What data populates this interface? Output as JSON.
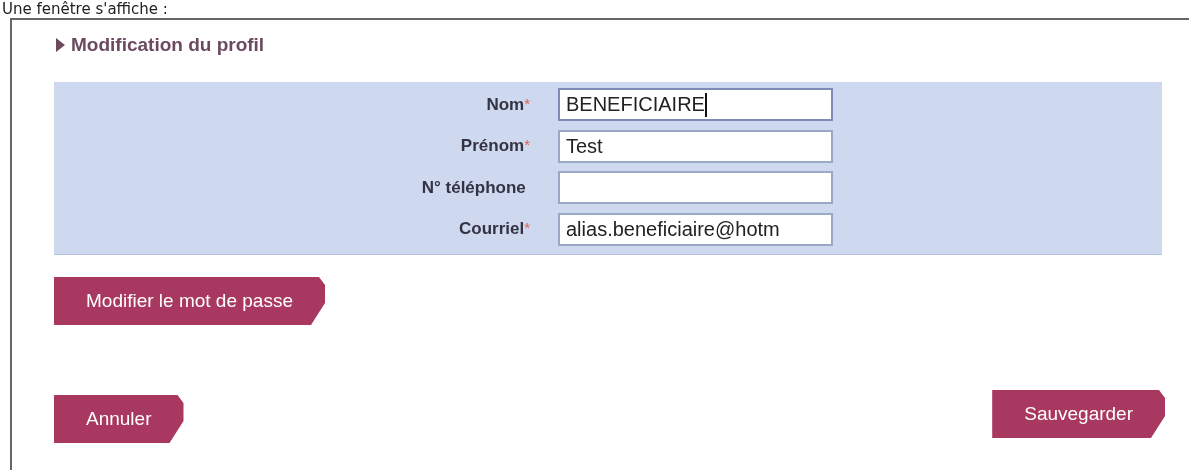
{
  "caption": "Une fenêtre s'affiche :",
  "title": "Modification du profil",
  "fields": [
    {
      "label": "Nom",
      "mark": "*",
      "value": "BENEFICIAIRE",
      "focused": true
    },
    {
      "label": "Prénom",
      "mark": "*",
      "value": "Test",
      "focused": false
    },
    {
      "label": "N° téléphone",
      "focused": false
    },
    {
      "label": "Courriel",
      "mark": "*",
      "value": "alias.beneficiaire@hotm",
      "focused": false
    }
  ],
  "password_button": "Modifier le mot de passe",
  "cancel_button": "Annuler",
  "save_button": "Sauvegarder"
}
